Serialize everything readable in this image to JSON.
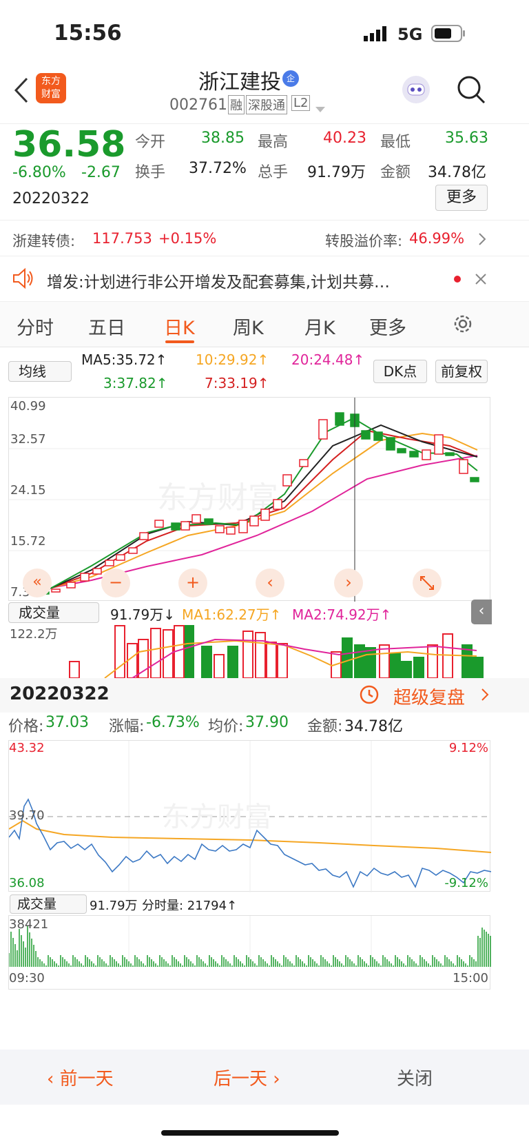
{
  "status": {
    "time": "15:56",
    "network": "5G"
  },
  "header": {
    "title": "浙江建投",
    "badge": "企",
    "code": "002761",
    "tags": [
      "融",
      "深股通",
      "L2"
    ],
    "logo": "东方\n财富"
  },
  "quote": {
    "price": "36.58",
    "pct": "-6.80%",
    "chg": "-2.67",
    "date": "20220322",
    "open_l": "今开",
    "open": "38.85",
    "high_l": "最高",
    "high": "40.23",
    "low_l": "最低",
    "low": "35.63",
    "turn_l": "换手",
    "turn": "37.72%",
    "vol_l": "总手",
    "vol": "91.79万",
    "amt_l": "金额",
    "amt": "34.78亿",
    "more": "更多"
  },
  "bond": {
    "name": "浙建转债:",
    "price": "117.753",
    "pct": "+0.15%",
    "prem_l": "转股溢价率:",
    "prem": "46.99%"
  },
  "notice": {
    "text": "增发:计划进行非公开增发及配套募集,计划共募…"
  },
  "tabs": [
    "分时",
    "五日",
    "日K",
    "周K",
    "月K",
    "更多"
  ],
  "ma": {
    "sel": "均线",
    "ma5": "MA5:35.72↑",
    "ma10": "10:29.92↑",
    "ma20": "20:24.48↑",
    "ma3": "3:37.82↑",
    "ma7": "7:33.19↑",
    "dk": "DK点",
    "fq": "前复权"
  },
  "kaxis": [
    "40.99",
    "32.57",
    "24.15",
    "15.72",
    "7.30"
  ],
  "vol": {
    "sel": "成交量",
    "v": "91.79万↓",
    "ma1": "MA1:62.27万↑",
    "ma2": "MA2:74.92万↑",
    "axis": "122.2万"
  },
  "detail": {
    "date": "20220322",
    "super": "超级复盘",
    "price_l": "价格:",
    "price": "37.03",
    "pct_l": "涨幅:",
    "pct": "-6.73%",
    "avg_l": "均价:",
    "avg": "37.90",
    "amt_l": "金额:",
    "amt": "34.78亿"
  },
  "intraday": {
    "top": "43.32",
    "mid": "39.70",
    "bot": "36.08",
    "ptop": "9.12%",
    "pbot": "-9.12%"
  },
  "ivol": {
    "sel": "成交量",
    "v": "91.79万",
    "fs": "分时量: 21794↑",
    "axis": "38421",
    "t0": "09:30",
    "t1": "15:00"
  },
  "bottom": {
    "prev": "前一天",
    "next": "后一天",
    "close": "关闭"
  },
  "watermark": "东方财富"
}
